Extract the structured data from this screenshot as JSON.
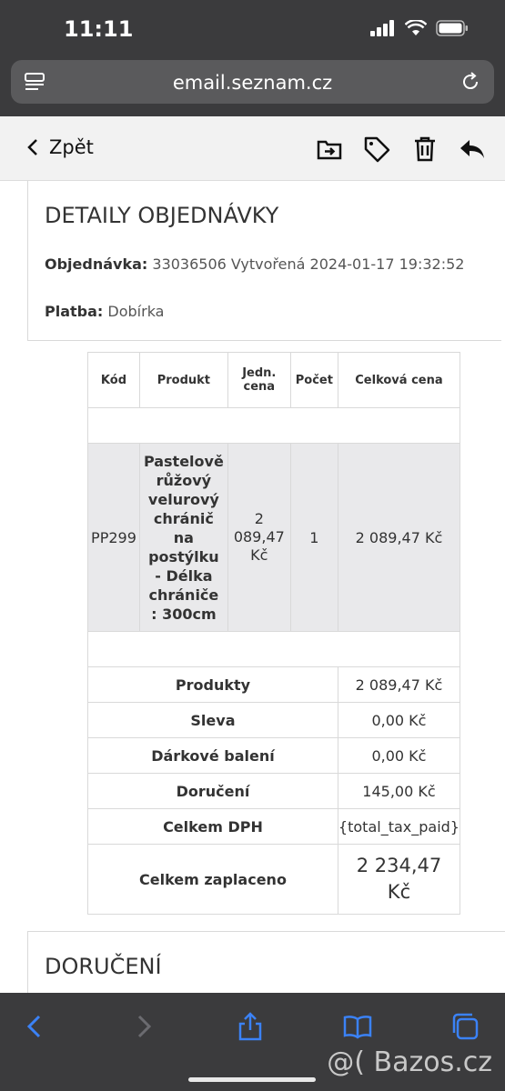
{
  "status": {
    "time": "11:11"
  },
  "browser": {
    "url": "email.seznam.cz"
  },
  "toolbar": {
    "back_label": "Zpět"
  },
  "order": {
    "title": "DETAILY OBJEDNÁVKY",
    "order_label": "Objednávka:",
    "order_value": "33036506 Vytvořená 2024-01-17 19:32:52",
    "payment_label": "Platba:",
    "payment_value": "Dobírka",
    "table": {
      "headers": [
        "Kód",
        "Produkt",
        "Jedn. cena",
        "Počet",
        "Celková cena"
      ],
      "row": {
        "code": "PP299",
        "product": "Pastelově růžový velurový chránič na postýlku - Délka chrániče : 300cm",
        "unit_price": "2 089,47 Kč",
        "qty": "1",
        "total": "2 089,47 Kč"
      },
      "summary": [
        {
          "label": "Produkty",
          "value": "2 089,47 Kč"
        },
        {
          "label": "Sleva",
          "value": "0,00 Kč"
        },
        {
          "label": "Dárkové balení",
          "value": "0,00 Kč"
        },
        {
          "label": "Doručení",
          "value": "145,00 Kč"
        },
        {
          "label": "Celkem DPH",
          "value": "{total_tax_paid}"
        },
        {
          "label": "Celkem zaplaceno",
          "value": "2 234,47 Kč"
        }
      ]
    }
  },
  "delivery": {
    "title": "DORUČENÍ"
  },
  "watermark": "@( Bazos.cz"
}
